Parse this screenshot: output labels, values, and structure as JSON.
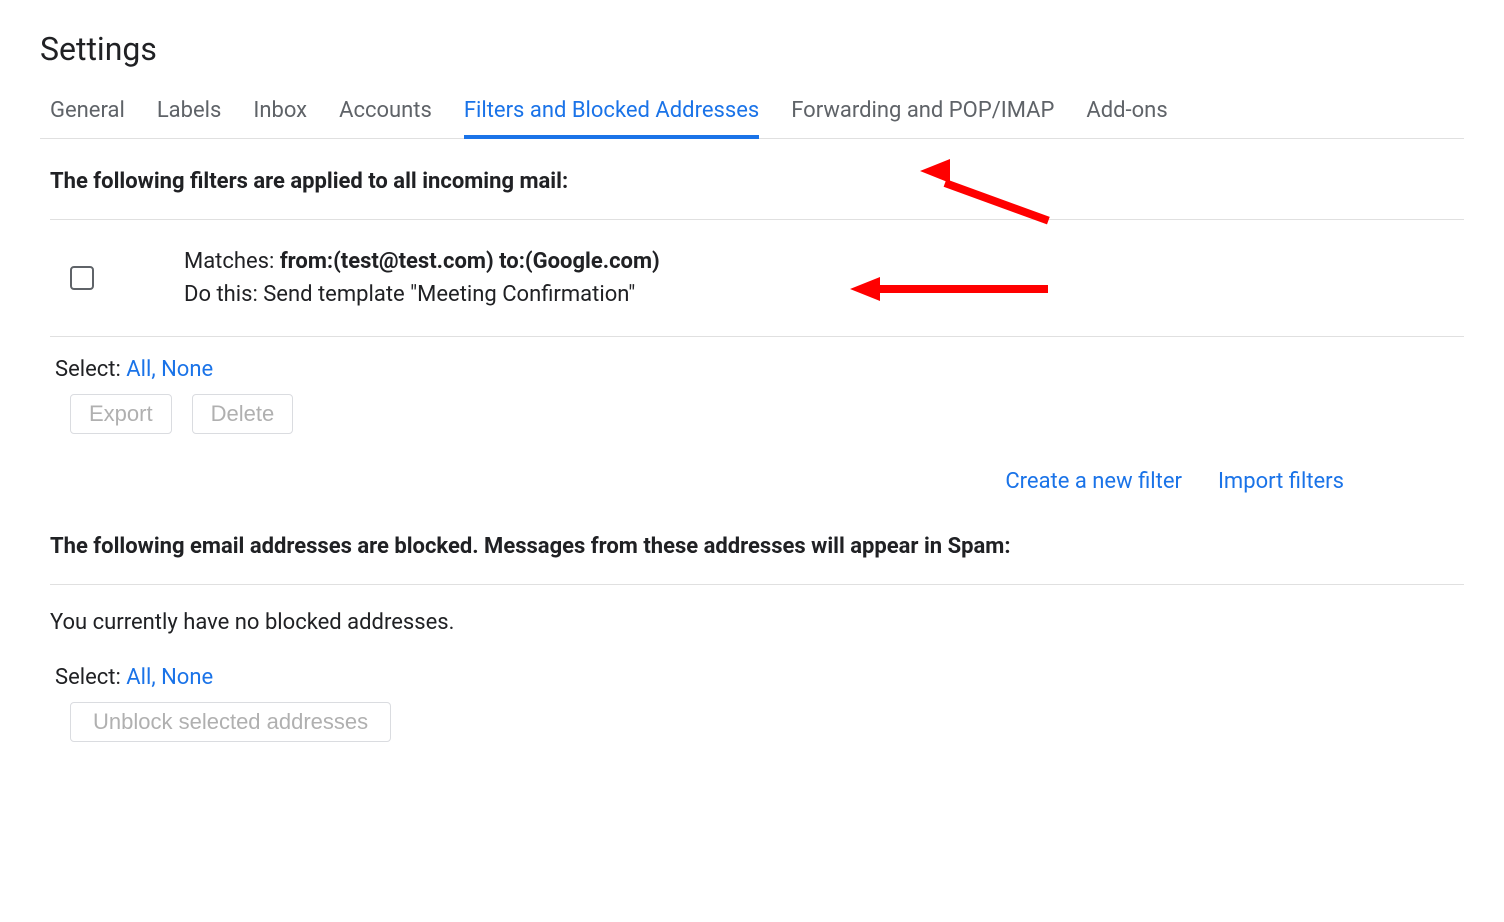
{
  "page_title": "Settings",
  "tabs": [
    {
      "label": "General",
      "active": false
    },
    {
      "label": "Labels",
      "active": false
    },
    {
      "label": "Inbox",
      "active": false
    },
    {
      "label": "Accounts",
      "active": false
    },
    {
      "label": "Filters and Blocked Addresses",
      "active": true
    },
    {
      "label": "Forwarding and POP/IMAP",
      "active": false
    },
    {
      "label": "Add-ons",
      "active": false
    }
  ],
  "filters_section": {
    "heading": "The following filters are applied to all incoming mail:",
    "filters": [
      {
        "matches_label": "Matches: ",
        "matches_criteria": "from:(test@test.com) to:(Google.com)",
        "action_label": "Do this: Send template \"Meeting Confirmation\""
      }
    ],
    "select_label": "Select: ",
    "select_all": "All",
    "select_none": "None",
    "export_button": "Export",
    "delete_button": "Delete",
    "create_filter_link": "Create a new filter",
    "import_filters_link": "Import filters"
  },
  "blocked_section": {
    "heading": "The following email addresses are blocked. Messages from these addresses will appear in Spam:",
    "empty_message": "You currently have no blocked addresses.",
    "select_label": "Select: ",
    "select_all": "All",
    "select_none": "None",
    "unblock_button": "Unblock selected addresses"
  }
}
